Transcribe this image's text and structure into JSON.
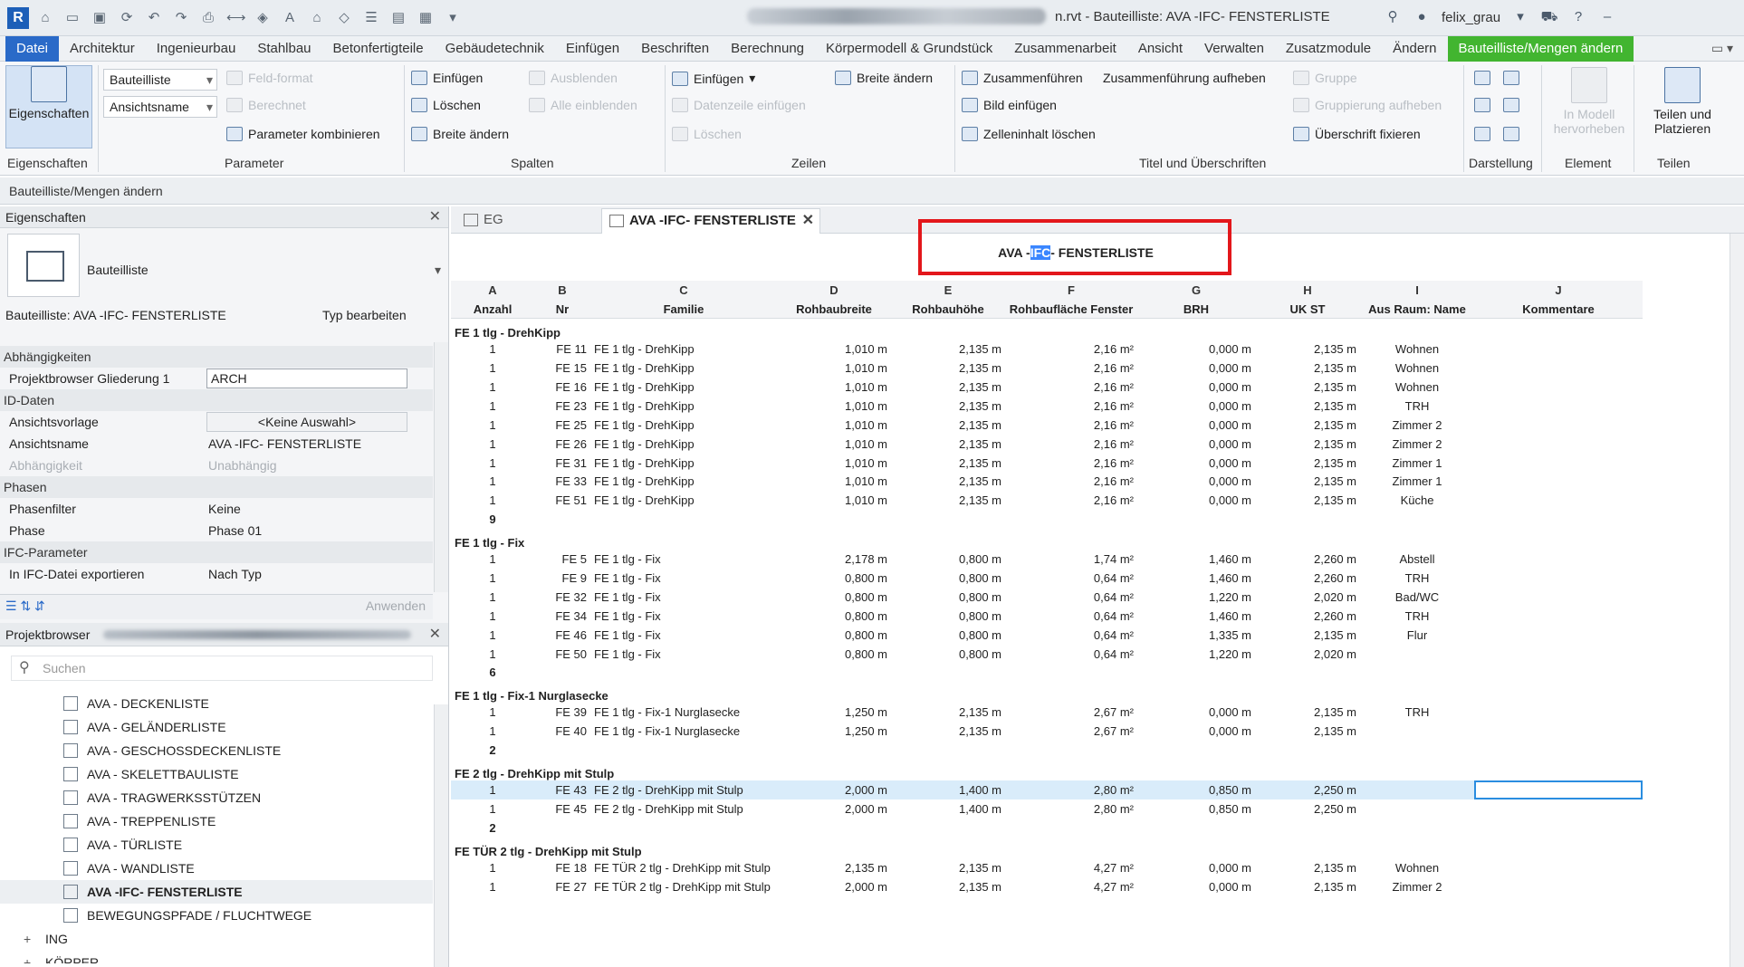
{
  "titlebar": {
    "logo": "R",
    "doc_title": "n.rvt - Bauteilliste: AVA -IFC- FENSTERLISTE",
    "user": "felix_grau"
  },
  "menu": [
    "Datei",
    "Architektur",
    "Ingenieurbau",
    "Stahlbau",
    "Betonfertigteile",
    "Gebäudetechnik",
    "Einfügen",
    "Beschriften",
    "Berechnung",
    "Körpermodell & Grundstück",
    "Zusammenarbeit",
    "Ansicht",
    "Verwalten",
    "Zusatzmodule",
    "Ändern",
    "Bauteilliste/Mengen ändern"
  ],
  "ribbon": {
    "eigenschaften": "Eigenschaften",
    "sel1": "Bauteilliste",
    "sel2": "Ansichtsname",
    "feldformat": "Feld-format",
    "berechnet": "Berechnet",
    "param_kombinieren": "Parameter kombinieren",
    "sp_einfuegen": "Einfügen",
    "sp_loeschen": "Löschen",
    "sp_breite": "Breite ändern",
    "ausblenden": "Ausblenden",
    "alle_einblenden": "Alle  einblenden",
    "z_einfuegen": "Einfügen",
    "datenzeile": "Datenzeile  einfügen",
    "z_loeschen": "Löschen",
    "z_breite": "Breite ändern",
    "zusammenfuehren": "Zusammenführen",
    "zus_aufheben": "Zusammenführung aufheben",
    "bild": "Bild  einfügen",
    "zelleninhalt": "Zelleninhalt  löschen",
    "gruppe": "Gruppe",
    "gruppierung": "Gruppierung aufheben",
    "ueberschrift": "Überschrift  fixieren",
    "in_modell": "In Modell hervorheben",
    "teilen": "Teilen und Platzieren",
    "groups": [
      "Eigenschaften",
      "Parameter",
      "Spalten",
      "Zeilen",
      "Titel und Überschriften",
      "Darstellung",
      "Element",
      "Teilen"
    ]
  },
  "context_bar": "Bauteilliste/Mengen ändern",
  "properties": {
    "header": "Eigenschaften",
    "type_name": "Bauteilliste",
    "instance": "Bauteilliste: AVA -IFC- FENSTERLISTE",
    "type_edit": "Typ bearbeiten",
    "rows": [
      {
        "cat": "Abhängigkeiten"
      },
      {
        "k": "Projektbrowser Gliederung 1",
        "v": "ARCH",
        "kind": "input"
      },
      {
        "cat": "ID-Daten"
      },
      {
        "k": "Ansichtsvorlage",
        "v": "<Keine Auswahl>",
        "kind": "button"
      },
      {
        "k": "Ansichtsname",
        "v": "AVA -IFC- FENSTERLISTE"
      },
      {
        "k": "Abhängigkeit",
        "v": "Unabhängig",
        "kind": "dim"
      },
      {
        "cat": "Phasen"
      },
      {
        "k": "Phasenfilter",
        "v": "Keine"
      },
      {
        "k": "Phase",
        "v": "Phase 01"
      },
      {
        "cat": "IFC-Parameter"
      },
      {
        "k": "In IFC-Datei exportieren",
        "v": "Nach Typ"
      }
    ],
    "apply": "Anwenden"
  },
  "project_browser": {
    "header": "Projektbrowser",
    "search_placeholder": "Suchen",
    "items": [
      "AVA - DECKENLISTE",
      "AVA - GELÄNDERLISTE",
      "AVA - GESCHOSSDECKENLISTE",
      "AVA - SKELETTBAULISTE",
      "AVA - TRAGWERKSSTÜTZEN",
      "AVA - TREPPENLISTE",
      "AVA - TÜRLISTE",
      "AVA - WANDLISTE",
      "AVA -IFC- FENSTERLISTE",
      "BEWEGUNGSPFADE / FLUCHTWEGE"
    ],
    "selected_index": 8,
    "nodes": [
      "ING",
      "KÖRPER"
    ]
  },
  "view_tabs": [
    "EG",
    "AVA -IFC- FENSTERLISTE"
  ],
  "schedule": {
    "title_pre": "AVA -",
    "title_hl": "IFC",
    "title_post": "- FENSTERLISTE",
    "letters": [
      "A",
      "B",
      "C",
      "D",
      "E",
      "F",
      "G",
      "H",
      "I",
      "J"
    ],
    "headers": [
      "Anzahl",
      "Nr",
      "Familie",
      "Rohbaubreite",
      "Rohbauhöhe",
      "Rohbaufläche Fenster",
      "BRH",
      "UK ST",
      "Aus Raum: Name",
      "Kommentare"
    ],
    "groups": [
      {
        "name": "FE 1 tlg - DrehKipp",
        "count": "9",
        "rows": [
          [
            "1",
            "FE 11",
            "FE 1 tlg - DrehKipp",
            "1,010 m",
            "2,135 m",
            "2,16 m²",
            "0,000 m",
            "2,135 m",
            "Wohnen",
            ""
          ],
          [
            "1",
            "FE 15",
            "FE 1 tlg - DrehKipp",
            "1,010 m",
            "2,135 m",
            "2,16 m²",
            "0,000 m",
            "2,135 m",
            "Wohnen",
            ""
          ],
          [
            "1",
            "FE 16",
            "FE 1 tlg - DrehKipp",
            "1,010 m",
            "2,135 m",
            "2,16 m²",
            "0,000 m",
            "2,135 m",
            "Wohnen",
            ""
          ],
          [
            "1",
            "FE 23",
            "FE 1 tlg - DrehKipp",
            "1,010 m",
            "2,135 m",
            "2,16 m²",
            "0,000 m",
            "2,135 m",
            "TRH",
            ""
          ],
          [
            "1",
            "FE 25",
            "FE 1 tlg - DrehKipp",
            "1,010 m",
            "2,135 m",
            "2,16 m²",
            "0,000 m",
            "2,135 m",
            "Zimmer 2",
            ""
          ],
          [
            "1",
            "FE 26",
            "FE 1 tlg - DrehKipp",
            "1,010 m",
            "2,135 m",
            "2,16 m²",
            "0,000 m",
            "2,135 m",
            "Zimmer 2",
            ""
          ],
          [
            "1",
            "FE 31",
            "FE 1 tlg - DrehKipp",
            "1,010 m",
            "2,135 m",
            "2,16 m²",
            "0,000 m",
            "2,135 m",
            "Zimmer 1",
            ""
          ],
          [
            "1",
            "FE 33",
            "FE 1 tlg - DrehKipp",
            "1,010 m",
            "2,135 m",
            "2,16 m²",
            "0,000 m",
            "2,135 m",
            "Zimmer 1",
            ""
          ],
          [
            "1",
            "FE 51",
            "FE 1 tlg - DrehKipp",
            "1,010 m",
            "2,135 m",
            "2,16 m²",
            "0,000 m",
            "2,135 m",
            "Küche",
            ""
          ]
        ]
      },
      {
        "name": "FE 1 tlg - Fix",
        "count": "6",
        "rows": [
          [
            "1",
            "FE 5",
            "FE 1 tlg - Fix",
            "2,178 m",
            "0,800 m",
            "1,74 m²",
            "1,460 m",
            "2,260 m",
            "Abstell",
            ""
          ],
          [
            "1",
            "FE 9",
            "FE 1 tlg - Fix",
            "0,800 m",
            "0,800 m",
            "0,64 m²",
            "1,460 m",
            "2,260 m",
            "TRH",
            ""
          ],
          [
            "1",
            "FE 32",
            "FE 1 tlg - Fix",
            "0,800 m",
            "0,800 m",
            "0,64 m²",
            "1,220 m",
            "2,020 m",
            "Bad/WC",
            ""
          ],
          [
            "1",
            "FE 34",
            "FE 1 tlg - Fix",
            "0,800 m",
            "0,800 m",
            "0,64 m²",
            "1,460 m",
            "2,260 m",
            "TRH",
            ""
          ],
          [
            "1",
            "FE 46",
            "FE 1 tlg - Fix",
            "0,800 m",
            "0,800 m",
            "0,64 m²",
            "1,335 m",
            "2,135 m",
            "Flur",
            ""
          ],
          [
            "1",
            "FE 50",
            "FE 1 tlg - Fix",
            "0,800 m",
            "0,800 m",
            "0,64 m²",
            "1,220 m",
            "2,020 m",
            "",
            ""
          ]
        ]
      },
      {
        "name": "FE 1 tlg - Fix-1 Nurglasecke",
        "count": "2",
        "rows": [
          [
            "1",
            "FE 39",
            "FE 1 tlg - Fix-1 Nurglasecke",
            "1,250 m",
            "2,135 m",
            "2,67 m²",
            "0,000 m",
            "2,135 m",
            "TRH",
            ""
          ],
          [
            "1",
            "FE 40",
            "FE 1 tlg - Fix-1 Nurglasecke",
            "1,250 m",
            "2,135 m",
            "2,67 m²",
            "0,000 m",
            "2,135 m",
            "",
            ""
          ]
        ]
      },
      {
        "name": "FE 2 tlg - DrehKipp mit Stulp",
        "count": "2",
        "rows": [
          [
            "1",
            "FE 43",
            "FE 2 tlg - DrehKipp mit Stulp",
            "2,000 m",
            "1,400 m",
            "2,80 m²",
            "0,850 m",
            "2,250 m",
            "",
            ""
          ],
          [
            "1",
            "FE 45",
            "FE 2 tlg - DrehKipp mit Stulp",
            "2,000 m",
            "1,400 m",
            "2,80 m²",
            "0,850 m",
            "2,250 m",
            "",
            ""
          ]
        ]
      },
      {
        "name": "FE TÜR 2 tlg - DrehKipp mit Stulp",
        "count": "",
        "rows": [
          [
            "1",
            "FE 18",
            "FE TÜR 2 tlg - DrehKipp mit Stulp",
            "2,135 m",
            "2,135 m",
            "4,27 m²",
            "0,000 m",
            "2,135 m",
            "Wohnen",
            ""
          ],
          [
            "1",
            "FE 27",
            "FE TÜR 2 tlg - DrehKipp mit Stulp",
            "2,000 m",
            "2,135 m",
            "4,27 m²",
            "0,000 m",
            "2,135 m",
            "Zimmer 2",
            ""
          ]
        ]
      }
    ]
  }
}
